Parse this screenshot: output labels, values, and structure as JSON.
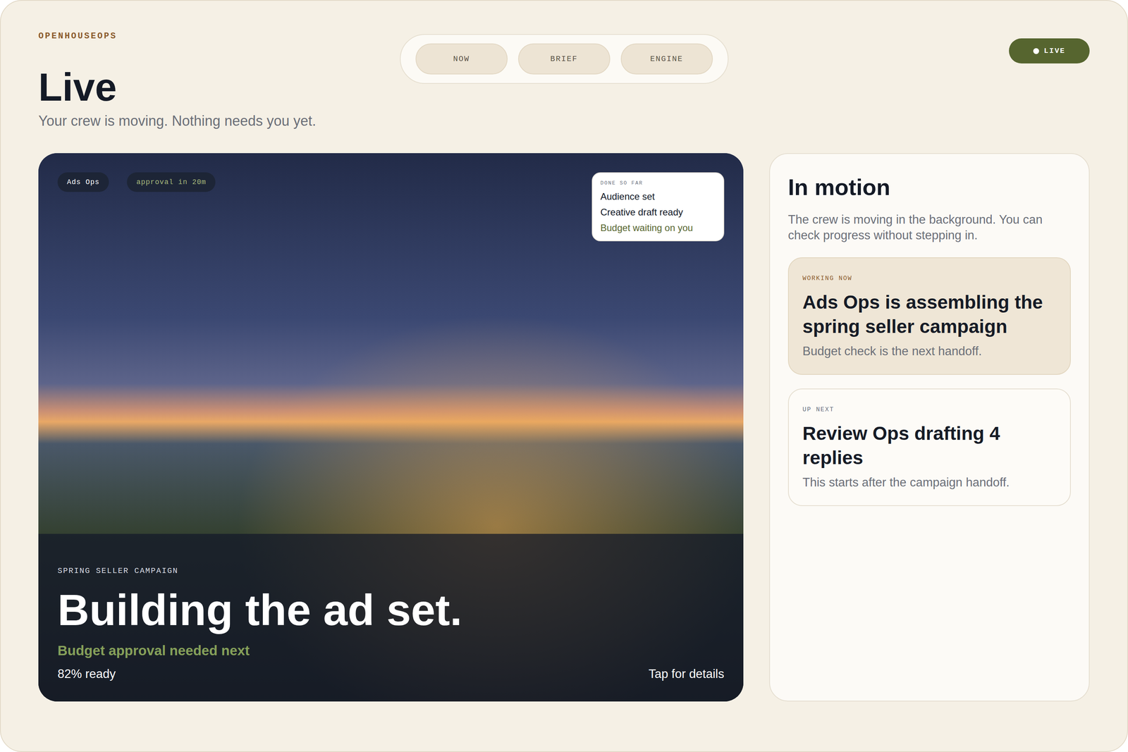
{
  "brand": "OPENHOUSEOPS",
  "tabs": [
    {
      "label": "NOW",
      "selected": false
    },
    {
      "label": "BRIEF",
      "selected": false
    },
    {
      "label": "ENGINE",
      "selected": false
    }
  ],
  "status_badge": {
    "label": "LIVE"
  },
  "page": {
    "title": "Live",
    "subtitle": "Your crew is moving. Nothing needs you yet."
  },
  "hero": {
    "tags": [
      {
        "label": "Ads Ops",
        "kind": "team"
      },
      {
        "label": "approval in 20m",
        "kind": "timer"
      }
    ],
    "done_card": {
      "title": "DONE SO FAR",
      "items": [
        {
          "label": "Audience set",
          "done": true
        },
        {
          "label": "Creative draft ready",
          "done": true
        },
        {
          "label": "Budget waiting on you",
          "done": false
        }
      ]
    },
    "eyebrow": "SPRING SELLER CAMPAIGN",
    "title": "Building the ad set.",
    "next": "Budget approval needed next",
    "progress": "82% ready",
    "action": "Tap for details"
  },
  "panel": {
    "title": "In motion",
    "description": "The crew is moving in the background. You can check progress without stepping in.",
    "cards": [
      {
        "label": "WORKING NOW",
        "title": "Ads Ops is assembling the spring seller campaign",
        "note": "Budget check is the next handoff.",
        "kind": "active"
      },
      {
        "label": "UP NEXT",
        "title": "Review Ops drafting 4 replies",
        "note": "This starts after the campaign handoff.",
        "kind": "queued"
      }
    ]
  }
}
